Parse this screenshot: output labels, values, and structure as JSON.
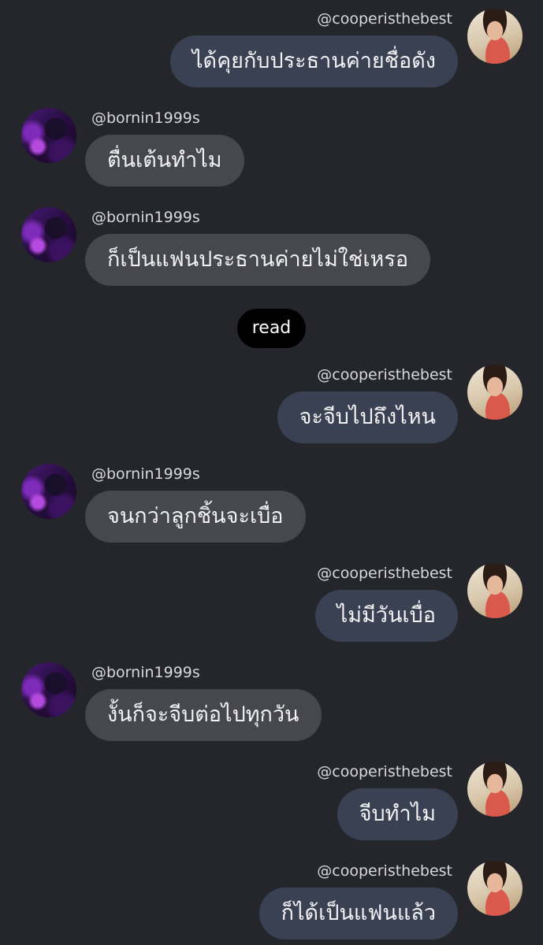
{
  "conversation": {
    "read_label": "read",
    "messages": [
      {
        "side": "right",
        "handle": "@cooperisthebest",
        "text": "ได้คุยกับประธานค่ายชื่อดัง",
        "avatar": "child-avatar"
      },
      {
        "side": "left",
        "handle": "@bornin1999s",
        "text": "ตื่นเต้นทำไม",
        "avatar": "purple-avatar"
      },
      {
        "side": "left",
        "handle": "@bornin1999s",
        "text": "ก็เป็นแฟนประธานค่ายไม่ใช่เหรอ",
        "avatar": "purple-avatar"
      },
      {
        "side": "right",
        "handle": "@cooperisthebest",
        "text": "จะจีบไปถึงไหน",
        "avatar": "child-avatar"
      },
      {
        "side": "left",
        "handle": "@bornin1999s",
        "text": "จนกว่าลูกชิ้นจะเบื่อ",
        "avatar": "purple-avatar"
      },
      {
        "side": "right",
        "handle": "@cooperisthebest",
        "text": "ไม่มีวันเบื่อ",
        "avatar": "child-avatar"
      },
      {
        "side": "left",
        "handle": "@bornin1999s",
        "text": "งั้นก็จะจีบต่อไปทุกวัน",
        "avatar": "purple-avatar"
      },
      {
        "side": "right",
        "handle": "@cooperisthebest",
        "text": "จีบทำไม",
        "avatar": "child-avatar"
      },
      {
        "side": "right",
        "handle": "@cooperisthebest",
        "text": "ก็ได้เป็นแฟนแล้ว",
        "avatar": "child-avatar"
      }
    ]
  },
  "colors": {
    "background": "#25262b",
    "incoming_bubble": "#47484e",
    "outgoing_bubble": "#3a4152",
    "read_pill": "#000000"
  }
}
